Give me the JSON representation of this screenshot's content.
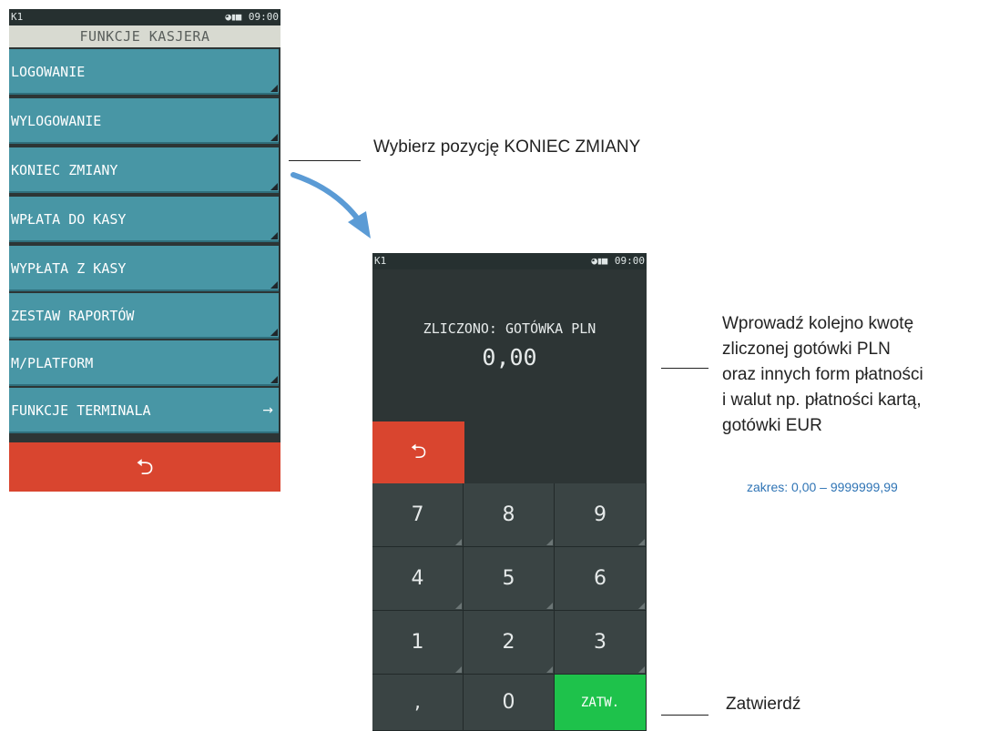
{
  "screen1": {
    "status": {
      "left": "K1",
      "icons": "◕▮■",
      "time": "09:00"
    },
    "title": "FUNKCJE KASJERA",
    "items": [
      {
        "label": "LOGOWANIE"
      },
      {
        "label": "WYLOGOWANIE"
      },
      {
        "label": "KONIEC ZMIANY"
      },
      {
        "label": "WPŁATA DO KASY"
      },
      {
        "label": "WYPŁATA Z KASY"
      },
      {
        "label": "ZESTAW RAPORTÓW"
      },
      {
        "label": "M/PLATFORM"
      },
      {
        "label": "FUNKCJE TERMINALA",
        "arrow": "→"
      }
    ],
    "back_symbol": "⮌"
  },
  "screen2": {
    "status": {
      "left": "K1",
      "icons": "◕▮■",
      "time": "09:00"
    },
    "label": "ZLICZONO: GOTÓWKA PLN",
    "value": "0,00",
    "back_symbol": "⮌",
    "keys": [
      "7",
      "8",
      "9",
      "4",
      "5",
      "6",
      "1",
      "2",
      "3",
      ",",
      "0",
      "ZATW."
    ]
  },
  "annotations": {
    "select": "Wybierz pozycję KONIEC ZMIANY",
    "enter_lines": [
      "Wprowadź kolejno kwotę",
      "zliczonej gotówki PLN",
      "oraz innych form płatności",
      "i walut np. płatności kartą,",
      "gotówki EUR"
    ],
    "range": "zakres: 0,00 – 9999999,99",
    "confirm": "Zatwierdź"
  },
  "colors": {
    "menu_item": "#4896a5",
    "background": "#2d3535",
    "back_button": "#d9452f",
    "ok_button": "#1ec24b",
    "arrow": "#5b9bd5",
    "range_text": "#2f74b5"
  }
}
